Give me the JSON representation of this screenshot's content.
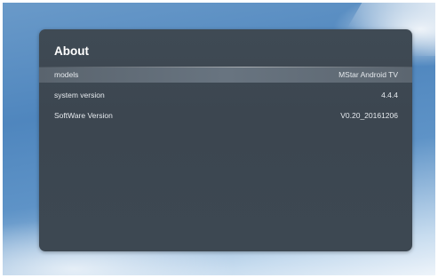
{
  "about": {
    "title": "About",
    "rows": [
      {
        "label": "models",
        "value": "MStar Android TV"
      },
      {
        "label": "system version",
        "value": "4.4.4"
      },
      {
        "label": "SoftWare Version",
        "value": "V0.20_20161206"
      }
    ]
  },
  "colors": {
    "panel": "#3f4a54",
    "selected_row": "#687480",
    "text": "#e6eaee",
    "wallpaper": "#4f86be"
  }
}
